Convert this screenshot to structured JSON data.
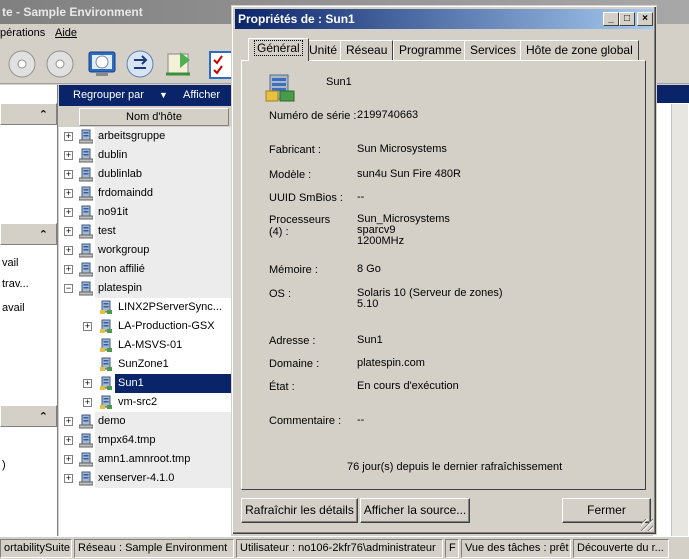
{
  "main_window": {
    "title": "te - Sample Environment",
    "menu": [
      "pérations",
      "Aide"
    ],
    "toolbar_icons": [
      "disc-icon",
      "disc-icon",
      "computer-icon",
      "network-refresh-icon",
      "scroll-icon",
      "checklist-icon"
    ]
  },
  "left_panel": {
    "section2_lines": [
      "vail",
      "trav...",
      "avail"
    ],
    "section3_lines": [
      ")"
    ]
  },
  "tree": {
    "toolbar": {
      "group_by": "Regrouper par",
      "show": "Afficher"
    },
    "column_header": "Nom d'hôte",
    "rows": [
      {
        "label": "arbeitsgruppe",
        "level": 0,
        "expander": "+"
      },
      {
        "label": "dublin",
        "level": 0,
        "expander": "+"
      },
      {
        "label": "dublinlab",
        "level": 0,
        "expander": "+"
      },
      {
        "label": "frdomaindd",
        "level": 0,
        "expander": "+"
      },
      {
        "label": "no91it",
        "level": 0,
        "expander": "+"
      },
      {
        "label": "test",
        "level": 0,
        "expander": "+"
      },
      {
        "label": "workgroup",
        "level": 0,
        "expander": "+"
      },
      {
        "label": "non affilié",
        "level": 0,
        "expander": "+"
      },
      {
        "label": "platespin",
        "level": 0,
        "expander": "-"
      },
      {
        "label": "LINX2PServerSync...",
        "level": 1,
        "expander": ""
      },
      {
        "label": "LA-Production-GSX",
        "level": 1,
        "expander": "+"
      },
      {
        "label": "LA-MSVS-01",
        "level": 1,
        "expander": ""
      },
      {
        "label": "SunZone1",
        "level": 1,
        "expander": ""
      },
      {
        "label": "Sun1",
        "level": 1,
        "expander": "+",
        "selected": true
      },
      {
        "label": "vm-src2",
        "level": 1,
        "expander": "+"
      },
      {
        "label": "demo",
        "level": 0,
        "expander": "+"
      },
      {
        "label": "tmpx64.tmp",
        "level": 0,
        "expander": "+"
      },
      {
        "label": "amn1.amnroot.tmp",
        "level": 0,
        "expander": "+"
      },
      {
        "label": "xenserver-4.1.0",
        "level": 0,
        "expander": "+"
      }
    ]
  },
  "statusbar": {
    "cells": [
      "ortabilitySuite",
      "Réseau : Sample Environment",
      "Utilisateur : no106-2kfr76\\administrateur",
      "F",
      "Vue des tâches : prêt",
      "Découverte du r..."
    ]
  },
  "dialog": {
    "title": "Propriétés de : Sun1",
    "caption_buttons": {
      "minimize": "_",
      "maximize": "□",
      "close": "×"
    },
    "tabs": [
      "Général",
      "Unité",
      "Réseau",
      "Programme",
      "Services",
      "Hôte de zone global"
    ],
    "active_tab": "Général",
    "header_name": "Sun1",
    "properties": [
      {
        "label": "Numéro de série :",
        "value": "2199740663"
      },
      {
        "label": "Fabricant :",
        "value": "Sun Microsystems"
      },
      {
        "label": "Modèle :",
        "value": "sun4u Sun Fire 480R"
      },
      {
        "label": "UUID SmBios :",
        "value": "--"
      },
      {
        "label": "Processeurs\n(4) :",
        "value": "Sun_Microsystems\nsparcv9\n1200MHz"
      },
      {
        "label": "Mémoire :",
        "value": "8 Go"
      },
      {
        "label": "OS :",
        "value": "Solaris 10 (Serveur de zones)\n5.10"
      },
      {
        "label": "Adresse :",
        "value": "Sun1"
      },
      {
        "label": "Domaine :",
        "value": "platespin.com"
      },
      {
        "label": "État :",
        "value": "En cours d'exécution"
      },
      {
        "label": "Commentaire :",
        "value": "--"
      }
    ],
    "refresh_note": "76 jour(s) depuis le dernier rafraîchissement",
    "buttons": {
      "refresh": "Rafraîchir les détails",
      "show_source": "Afficher la source...",
      "close": "Fermer"
    }
  }
}
